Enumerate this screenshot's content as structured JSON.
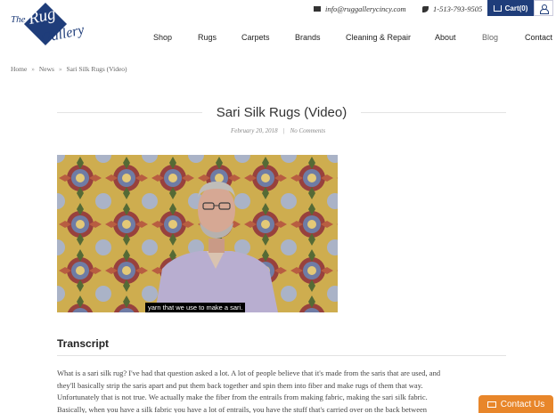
{
  "logo": {
    "the": "The",
    "rug": "Rug",
    "gallery": "Gallery"
  },
  "topbar": {
    "email": "info@ruggallerycincy.com",
    "phone": "1-513-793-9505",
    "cart_label": "Cart(0)"
  },
  "nav": {
    "items": [
      "Shop",
      "Rugs",
      "Carpets",
      "Brands",
      "Cleaning & Repair",
      "About",
      "Blog",
      "Contact"
    ]
  },
  "breadcrumb": {
    "items": [
      "Home",
      "News",
      "Sari Silk Rugs (Video)"
    ],
    "separator": "»"
  },
  "post": {
    "title": "Sari Silk Rugs (Video)",
    "date": "February 20, 2018",
    "meta_separator": "|",
    "comments": "No Comments"
  },
  "video": {
    "caption": "yarn that we use to make a sari."
  },
  "transcript": {
    "heading": "Transcript",
    "lines": [
      "What is a sari silk rug? I've had that question asked a lot. A lot of people believe that it's made from the saris that are used, and",
      "they'll basically strip the saris apart and put them back together and spin them into fiber and make rugs of them that way.",
      "Unfortunately that is not true. We actually make the fiber from the entrails from making fabric, making the sari silk fabric.",
      "Basically, when you have a silk fabric you have a lot of entrails, you have the stuff that's carried over on the back between"
    ]
  },
  "contact_us": {
    "label": "Contact Us"
  },
  "colors": {
    "brand": "#1f3d7a",
    "accent": "#e8862a"
  }
}
